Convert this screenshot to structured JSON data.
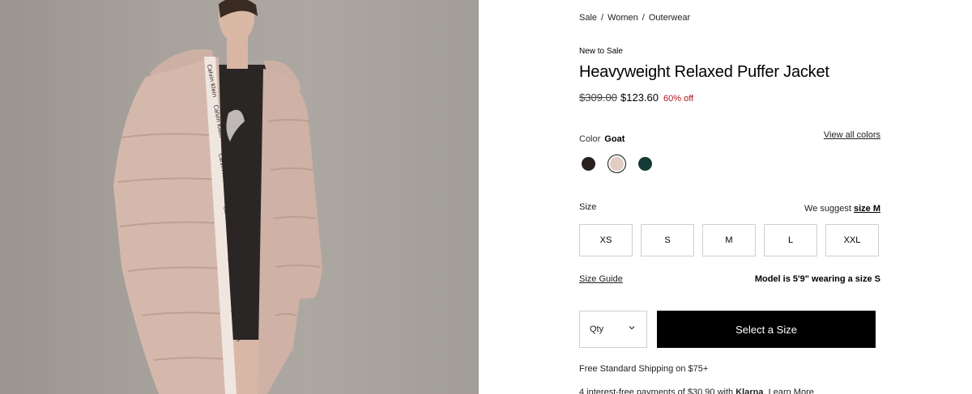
{
  "breadcrumb": [
    {
      "label": "Sale"
    },
    {
      "label": "Women"
    },
    {
      "label": "Outerwear"
    }
  ],
  "breadcrumb_separator": "/",
  "product": {
    "badge": "New to Sale",
    "title": "Heavyweight Relaxed Puffer Jacket",
    "price_original": "$309.00",
    "price_sale": "$123.60",
    "discount": "60% off",
    "image_alt_brand": "Calvin Klein"
  },
  "color": {
    "label": "Color",
    "selected": "Goat",
    "view_all": "View all colors",
    "swatches": [
      {
        "name": "black-brown",
        "hex": "#2a211e",
        "selected": false
      },
      {
        "name": "goat",
        "hex": "#e2cdc2",
        "selected": true
      },
      {
        "name": "dark-green",
        "hex": "#163a36",
        "selected": false
      }
    ]
  },
  "size": {
    "label": "Size",
    "suggest_prefix": "We suggest",
    "suggest_value": "size M",
    "options": [
      "XS",
      "S",
      "M",
      "L",
      "XXL"
    ],
    "guide": "Size Guide",
    "model_info": "Model is 5'9\" wearing a size S"
  },
  "cart": {
    "qty_label": "Qty",
    "cta": "Select a Size"
  },
  "shipping": "Free Standard Shipping on $75+",
  "klarna": {
    "prefix": "4 interest-free payments of $30.90 with",
    "brand": "Klarna",
    "learn": "Learn More"
  },
  "colors": {
    "accent_red": "#b3141b",
    "cta_bg": "#000000"
  }
}
